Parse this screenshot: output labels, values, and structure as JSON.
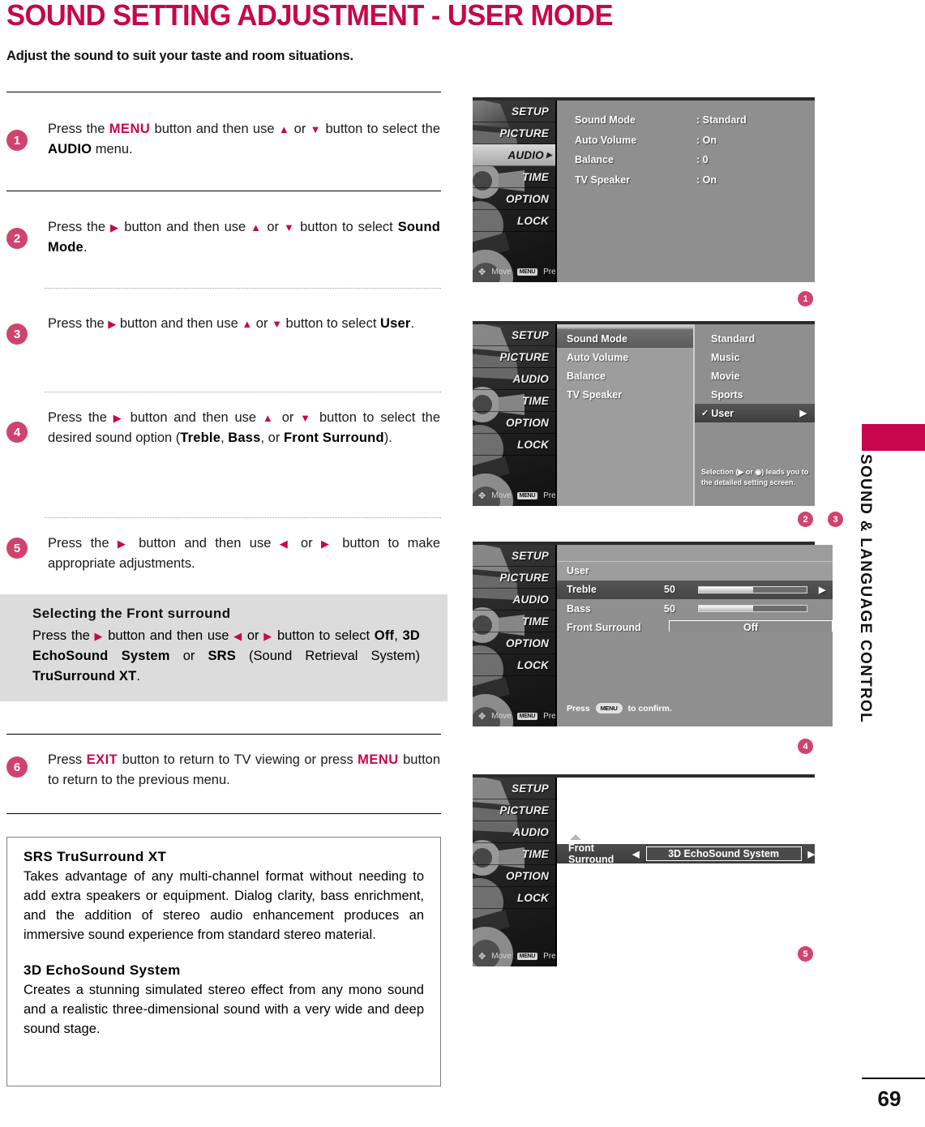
{
  "header": {
    "title": "SOUND SETTING ADJUSTMENT - USER MODE",
    "subtitle": "Adjust the sound to suit your taste and room situations."
  },
  "steps": [
    {
      "num": "1",
      "html": "Press the <b class=\"pink\">MENU</b> button and then use <span class=\"tri\">▲</span> or <span class=\"tri\">▼</span> button to select the <b class=\"k\">AUDIO</b> menu."
    },
    {
      "num": "2",
      "html": "Press the <span class=\"tri\">▶</span> button and then use <span class=\"tri\">▲</span> or <span class=\"tri\">▼</span> button to select <b class=\"k\">Sound Mode</b>."
    },
    {
      "num": "3",
      "html": "Press the <span class=\"tri\">▶</span> button and then use <span class=\"tri\">▲</span> or <span class=\"tri\">▼</span> button to select <b class=\"k\">User</b>."
    },
    {
      "num": "4",
      "html": "Press the <span class=\"tri\">▶</span> button and then use <span class=\"tri\">▲</span> or <span class=\"tri\">▼</span> button to select the desired sound option (<b class=\"k\">Treble</b>, <b class=\"k\">Bass</b>, or <b class=\"k\">Front Surround</b>)."
    },
    {
      "num": "5",
      "html": "Press the <span class=\"tri\">▶</span> button and then use <span class=\"tri\">◀</span> or <span class=\"tri\">▶</span> button to make appropriate adjustments."
    },
    {
      "num": "6",
      "html": "Press <b class=\"pink\">EXIT</b> button to return to TV viewing or press <b class=\"pink\">MENU</b> button to return to the previous menu."
    }
  ],
  "note_box": {
    "heading": "Selecting the Front surround",
    "html": "Press the <span class=\"tri\">▶</span> button and then use <span class=\"tri\">◀</span> or <span class=\"tri\">▶</span> button to select <b class=\"k\">Off</b>, <b class=\"k\">3D EchoSound System</b> or <b class=\"k\">SRS</b> (Sound Retrieval System) <b class=\"k\">TruSurround XT</b>."
  },
  "info_box": {
    "section1_title": "SRS TruSurround XT",
    "section1_body": "Takes advantage of any multi-channel format without needing to add extra speakers or equipment. Dialog clarity, bass enrichment, and the addition of stereo audio enhancement produces an immersive sound experience from standard stereo material.",
    "section2_title": "3D EchoSound System",
    "section2_body": "Creates a stunning simulated stereo effect from any mono sound and a realistic three-dimensional sound with a very wide and deep sound stage."
  },
  "osd": {
    "menu_items": [
      "SETUP",
      "PICTURE",
      "AUDIO",
      "TIME",
      "OPTION",
      "LOCK"
    ],
    "footer": {
      "move": "Move",
      "menu_key": "MENU",
      "prev": "Prev"
    },
    "screen1": {
      "rows": [
        {
          "label": "Sound Mode",
          "value": ": Standard"
        },
        {
          "label": "Auto Volume",
          "value": ": On"
        },
        {
          "label": "Balance",
          "value": ": 0"
        },
        {
          "label": "TV Speaker",
          "value": ": On"
        }
      ],
      "marker": "1"
    },
    "screen2": {
      "left_items": [
        "Sound Mode",
        "Auto Volume",
        "Balance",
        "TV Speaker"
      ],
      "options": [
        "Standard",
        "Music",
        "Movie",
        "Sports"
      ],
      "selected_option": "User",
      "check_glyph": "✓",
      "right_arrow": "▶",
      "hint": "Selection (▶ or ◉) leads you  to the detailed setting screen.",
      "markers": [
        "2",
        "3"
      ]
    },
    "screen3": {
      "title": "User",
      "rows": [
        {
          "label": "Treble",
          "value": "50",
          "percent": 50
        },
        {
          "label": "Bass",
          "value": "50",
          "percent": 50
        }
      ],
      "front_surround_label": "Front Surround",
      "front_surround_value": "Off",
      "press_prefix": "Press",
      "press_key": "MENU",
      "press_suffix": "to confirm.",
      "marker": "4"
    },
    "screen4": {
      "label": "Front Surround",
      "value": "3D EchoSound System",
      "left_arrow": "◀",
      "right_arrow": "▶",
      "marker": "5"
    }
  },
  "sidebar": {
    "chapter": "SOUND & LANGUAGE CONTROL",
    "page_number": "69"
  },
  "colors": {
    "accent": "#C8064B",
    "badge": "#D0436E",
    "note_bg": "#DCDCDC"
  }
}
